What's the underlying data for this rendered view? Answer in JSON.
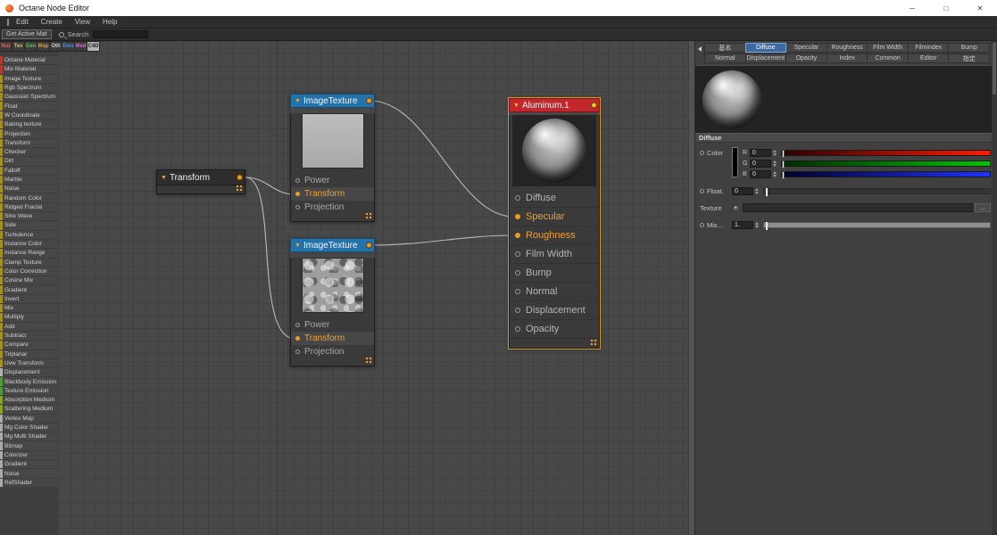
{
  "window": {
    "title": "Octane Node Editor",
    "controls": {
      "minimize": "─",
      "maximize": "□",
      "close": "✕"
    }
  },
  "menu": {
    "items": [
      {
        "label": "Edit"
      },
      {
        "label": "Create"
      },
      {
        "label": "View"
      },
      {
        "label": "Help"
      }
    ]
  },
  "toolbar": {
    "get_active_mat": "Get Active Mat",
    "search_label": "Search"
  },
  "category_tabs": [
    {
      "label": "Mat",
      "color": "#e0564e"
    },
    {
      "label": "Tex",
      "color": "#d8c443"
    },
    {
      "label": "Gen",
      "color": "#5fc24e"
    },
    {
      "label": "Map",
      "color": "#d89a3c"
    },
    {
      "label": "Oth",
      "color": "#cfcfcf"
    },
    {
      "label": "Ems",
      "color": "#5b8fe0"
    },
    {
      "label": "Med",
      "color": "#d363d3"
    },
    {
      "label": "C4D",
      "color": "#222222",
      "cls": "selected"
    }
  ],
  "sidebar": {
    "items": [
      {
        "label": "Octane Material",
        "color": "#b23b2e"
      },
      {
        "label": "Mix Material",
        "color": "#b23b2e"
      },
      {
        "label": "Image Texture",
        "color": "#a58f22"
      },
      {
        "label": "Rgb Spectrum",
        "color": "#a58f22"
      },
      {
        "label": "Gaussian Spectrum",
        "color": "#a58f22"
      },
      {
        "label": "Float",
        "color": "#a58f22"
      },
      {
        "label": "W Coordinate",
        "color": "#a58f22"
      },
      {
        "label": "Baking texture",
        "color": "#a58f22"
      },
      {
        "label": "Projection",
        "color": "#a58f22"
      },
      {
        "label": "Transform",
        "color": "#a58f22"
      },
      {
        "label": "Checker",
        "color": "#a58f22"
      },
      {
        "label": "Dirt",
        "color": "#a58f22"
      },
      {
        "label": "Falloff",
        "color": "#a58f22"
      },
      {
        "label": "Marble",
        "color": "#a58f22"
      },
      {
        "label": "Noise",
        "color": "#a58f22"
      },
      {
        "label": "Random Color",
        "color": "#a58f22"
      },
      {
        "label": "Ridged Fractal",
        "color": "#a58f22"
      },
      {
        "label": "Sine Wave",
        "color": "#a58f22"
      },
      {
        "label": "Side",
        "color": "#a58f22"
      },
      {
        "label": "Turbulence",
        "color": "#a58f22"
      },
      {
        "label": "Instance Color",
        "color": "#a58f22"
      },
      {
        "label": "Instance Range",
        "color": "#a58f22"
      },
      {
        "label": "Clamp Texture",
        "color": "#a58f22"
      },
      {
        "label": "Color Correction",
        "color": "#a58f22"
      },
      {
        "label": "Cosine Mix",
        "color": "#a58f22"
      },
      {
        "label": "Gradient",
        "color": "#a58f22"
      },
      {
        "label": "Invert",
        "color": "#a58f22"
      },
      {
        "label": "Mix",
        "color": "#a58f22"
      },
      {
        "label": "Multiply",
        "color": "#a58f22"
      },
      {
        "label": "Add",
        "color": "#a58f22"
      },
      {
        "label": "Subtract",
        "color": "#a58f22"
      },
      {
        "label": "Compare",
        "color": "#a58f22"
      },
      {
        "label": "Triplanar",
        "color": "#a58f22"
      },
      {
        "label": "Uvw Transform",
        "color": "#a58f22"
      },
      {
        "label": "Displacement",
        "color": "#b0b0b0"
      },
      {
        "label": "Blackbody Emission",
        "color": "#4e9a3c"
      },
      {
        "label": "Texture Emission",
        "color": "#4e9a3c"
      },
      {
        "label": "Absorption Medium",
        "color": "#86a32a"
      },
      {
        "label": "Scattering Medium",
        "color": "#86a32a"
      },
      {
        "label": "Vertex Map",
        "color": "#aaaaaa"
      },
      {
        "label": "Mg Color Shader",
        "color": "#aaaaaa"
      },
      {
        "label": "Mg Multi Shader",
        "color": "#aaaaaa"
      },
      {
        "label": "Bitmap",
        "color": "#aaaaaa"
      },
      {
        "label": "Colorizer",
        "color": "#aaaaaa"
      },
      {
        "label": "Gradient",
        "color": "#aaaaaa"
      },
      {
        "label": "Noise",
        "color": "#aaaaaa"
      },
      {
        "label": "RefShader",
        "color": "#aaaaaa"
      }
    ]
  },
  "nodes": {
    "transform": {
      "title": "Transform"
    },
    "image_texture_top": {
      "title": "ImageTexture",
      "rows": [
        {
          "label": "Power"
        },
        {
          "label": "Transform",
          "state": "active"
        },
        {
          "label": "Projection"
        }
      ]
    },
    "image_texture_bottom": {
      "title": "ImageTexture",
      "rows": [
        {
          "label": "Power"
        },
        {
          "label": "Transform",
          "state": "active"
        },
        {
          "label": "Projection"
        }
      ]
    },
    "aluminum": {
      "title": "Aluminum.1",
      "rows": [
        {
          "label": "Diffuse"
        },
        {
          "label": "Specular",
          "state": "active"
        },
        {
          "label": "Roughness",
          "state": "active"
        },
        {
          "label": "Film Width"
        },
        {
          "label": "Bump"
        },
        {
          "label": "Normal"
        },
        {
          "label": "Displacement"
        },
        {
          "label": "Opacity"
        }
      ]
    }
  },
  "properties": {
    "tabs_row1": [
      {
        "label": "基本"
      },
      {
        "label": "Diffuse",
        "cls": "selected"
      },
      {
        "label": "Specular"
      },
      {
        "label": "Roughness"
      },
      {
        "label": "Film Width"
      },
      {
        "label": "Filmindex"
      },
      {
        "label": "Bump"
      }
    ],
    "tabs_row2": [
      {
        "label": "Normal"
      },
      {
        "label": "Displacement"
      },
      {
        "label": "Opacity"
      },
      {
        "label": "Index"
      },
      {
        "label": "Common"
      },
      {
        "label": "Editor"
      },
      {
        "label": "指定"
      }
    ],
    "section_title": "Diffuse",
    "color_label": "Color",
    "channels": [
      {
        "label": "R",
        "value": "0",
        "grad": "red"
      },
      {
        "label": "G",
        "value": "0",
        "grad": "green"
      },
      {
        "label": "B",
        "value": "0",
        "grad": "blue"
      }
    ],
    "float_label": "Float.",
    "float_value": "0",
    "texture_label": "Texture",
    "texture_more": "...",
    "mix_label": "Mix...",
    "mix_value": "1."
  }
}
